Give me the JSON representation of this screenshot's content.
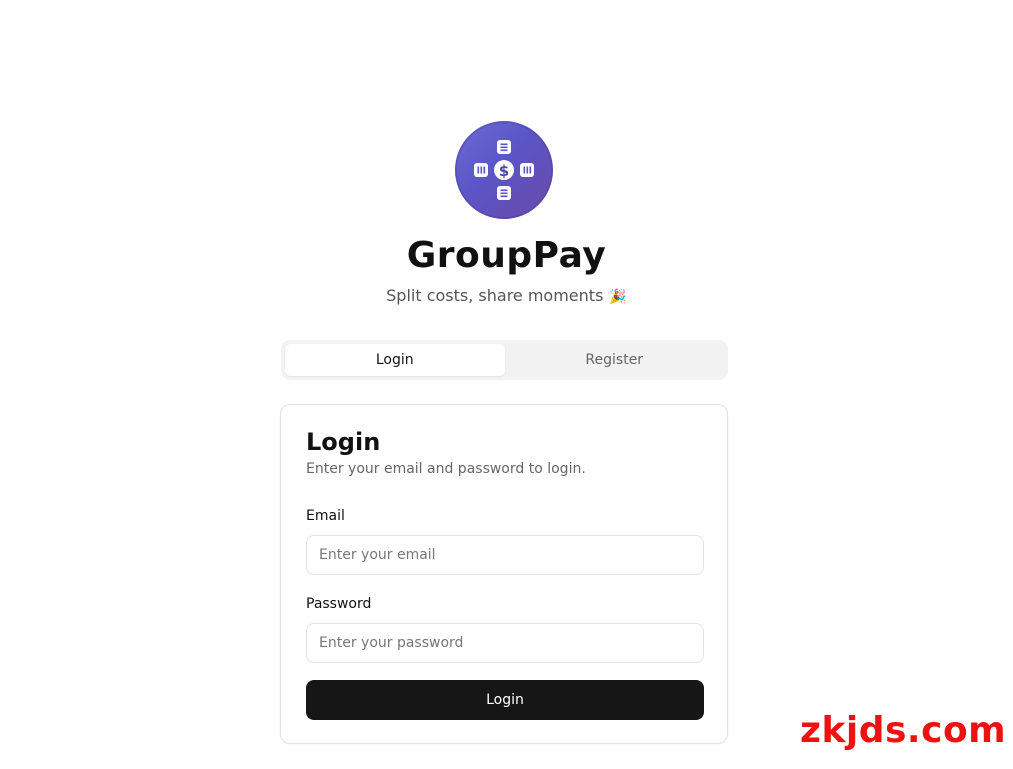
{
  "app": {
    "title": "GroupPay",
    "tagline": "Split costs, share moments",
    "tagline_emoji": "🎉",
    "logo_icon": "dollar-group-icon"
  },
  "tabs": [
    {
      "label": "Login",
      "active": true
    },
    {
      "label": "Register",
      "active": false
    }
  ],
  "login_card": {
    "title": "Login",
    "description": "Enter your email and password to login.",
    "email": {
      "label": "Email",
      "value": "",
      "placeholder": "Enter your email"
    },
    "password": {
      "label": "Password",
      "value": "",
      "placeholder": "Enter your password"
    },
    "submit_label": "Login"
  },
  "watermark": "zkjds.com",
  "colors": {
    "logo_gradient_start": "#6a6cd6",
    "logo_gradient_end": "#6a4aa8",
    "primary_button": "#161616",
    "watermark": "#ee1111"
  }
}
